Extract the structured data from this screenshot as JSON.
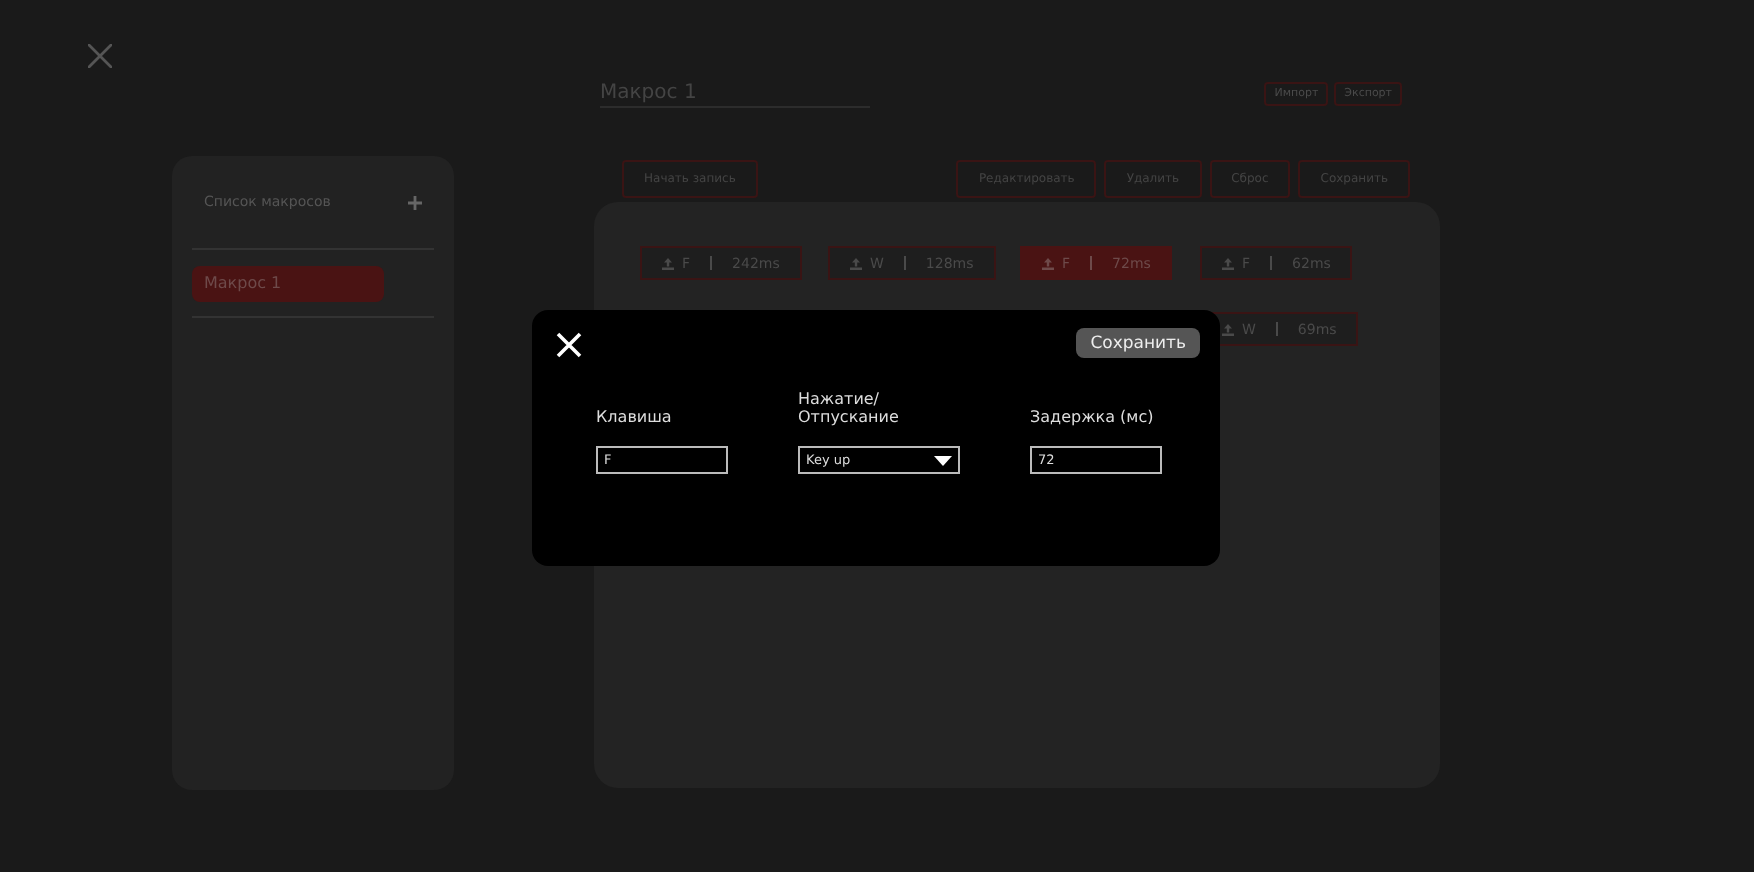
{
  "macro_name": {
    "value": "Макрос 1"
  },
  "top_buttons": [
    "Импорт",
    "Экспорт"
  ],
  "sidebar": {
    "title": "Список макросов",
    "items": [
      {
        "label": "Макрос 1",
        "selected": true
      }
    ]
  },
  "record_button": "Начать запись",
  "action_buttons": [
    "Редактировать",
    "Удалить",
    "Сброс",
    "Сохранить"
  ],
  "steps": [
    {
      "key": "F",
      "delay": "242ms",
      "selected": false
    },
    {
      "key": "W",
      "delay": "128ms",
      "selected": false
    },
    {
      "key": "F",
      "delay": "72ms",
      "selected": true
    },
    {
      "key": "F",
      "delay": "62ms",
      "selected": false
    },
    {
      "key": "W",
      "delay": "69ms",
      "selected": false
    }
  ],
  "dialog": {
    "save_button": "Сохранить",
    "fields": [
      {
        "kind": "text",
        "label": "Клавиша",
        "value": "F"
      },
      {
        "kind": "select",
        "label": "Нажатие/ Отпускание",
        "value": "Key up"
      },
      {
        "kind": "text",
        "label": "Задержка (мс)",
        "value": "72"
      }
    ]
  }
}
